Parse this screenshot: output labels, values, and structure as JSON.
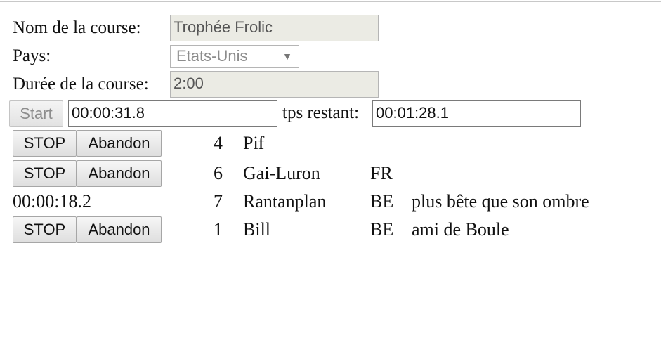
{
  "form": {
    "nom_label": "Nom de la course:",
    "nom_value": "Trophée Frolic",
    "pays_label": "Pays:",
    "pays_value": "Etats-Unis",
    "duree_label": "Durée de la course:",
    "duree_value": "2:00",
    "start_label": "Start",
    "elapsed_value": "00:00:31.8",
    "remaining_label": "tps restant:",
    "remaining_value": "00:01:28.1"
  },
  "buttons": {
    "stop": "STOP",
    "abandon": "Abandon"
  },
  "runners": [
    {
      "num": "4",
      "name": "Pif",
      "country": "",
      "note": ""
    },
    {
      "num": "6",
      "name": "Gai-Luron",
      "country": "FR",
      "note": ""
    },
    {
      "time": "00:00:18.2",
      "num": "7",
      "name": "Rantanplan",
      "country": "BE",
      "note": "plus bête que son ombre"
    },
    {
      "num": "1",
      "name": "Bill",
      "country": "BE",
      "note": "ami de Boule"
    }
  ]
}
